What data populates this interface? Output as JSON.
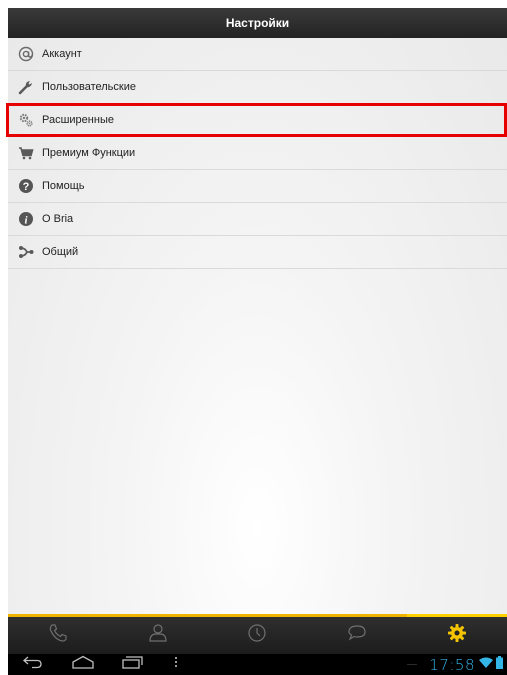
{
  "header": {
    "title": "Настройки"
  },
  "menu": {
    "items": [
      {
        "label": "Аккаунт",
        "icon": "at-sign-icon"
      },
      {
        "label": "Пользовательские",
        "icon": "wrench-icon"
      },
      {
        "label": "Расширенные",
        "icon": "gears-icon",
        "highlighted": true
      },
      {
        "label": "Премиум Функции",
        "icon": "cart-icon"
      },
      {
        "label": "Помощь",
        "icon": "help-icon"
      },
      {
        "label": "О Bria",
        "icon": "info-icon"
      },
      {
        "label": "Общий",
        "icon": "share-icon"
      }
    ]
  },
  "tab_bar": {
    "tabs": [
      {
        "icon": "phone-icon"
      },
      {
        "icon": "contacts-icon"
      },
      {
        "icon": "history-clock-icon"
      },
      {
        "icon": "chat-bubble-icon"
      },
      {
        "icon": "settings-gear-icon",
        "active": true
      }
    ],
    "accent_color": "#f0b400"
  },
  "status_bar": {
    "time": "17:58",
    "time_color": "#33b5e5"
  },
  "colors": {
    "highlight_border": "#e60000"
  }
}
